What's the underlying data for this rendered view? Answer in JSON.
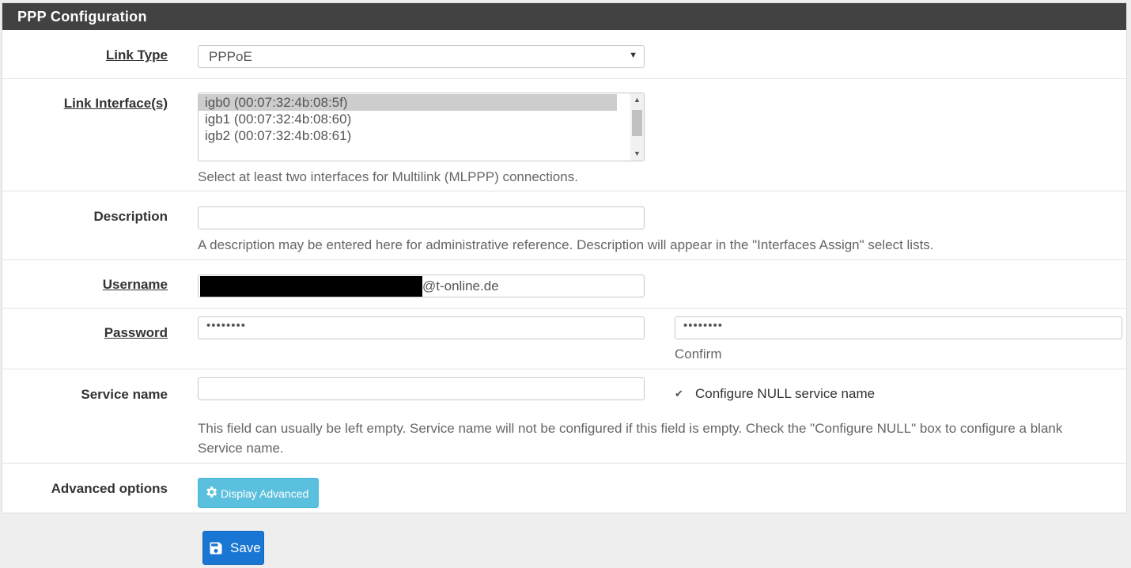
{
  "panel": {
    "title": "PPP Configuration"
  },
  "link_type": {
    "label": "Link Type",
    "value": "PPPoE"
  },
  "link_interfaces": {
    "label": "Link Interface(s)",
    "options": [
      "igb0 (00:07:32:4b:08:5f)",
      "igb1 (00:07:32:4b:08:60)",
      "igb2 (00:07:32:4b:08:61)"
    ],
    "selected": 0,
    "help": "Select at least two interfaces for Multilink (MLPPP) connections."
  },
  "description": {
    "label": "Description",
    "value": "",
    "help": "A description may be entered here for administrative reference. Description will appear in the \"Interfaces Assign\" select lists."
  },
  "username": {
    "label": "Username",
    "visible_suffix": "@t-online.de"
  },
  "password": {
    "label": "Password",
    "value_masked": "••••••••",
    "confirm_masked": "••••••••",
    "confirm_help": "Confirm"
  },
  "service_name": {
    "label": "Service name",
    "value": "",
    "null_checkbox_label": "Configure NULL service name",
    "null_checked": true,
    "help": "This field can usually be left empty. Service name will not be configured if this field is empty. Check the \"Configure NULL\" box to configure a blank Service name."
  },
  "advanced": {
    "label": "Advanced options",
    "button_label": "Display Advanced"
  },
  "save": {
    "label": "Save"
  }
}
